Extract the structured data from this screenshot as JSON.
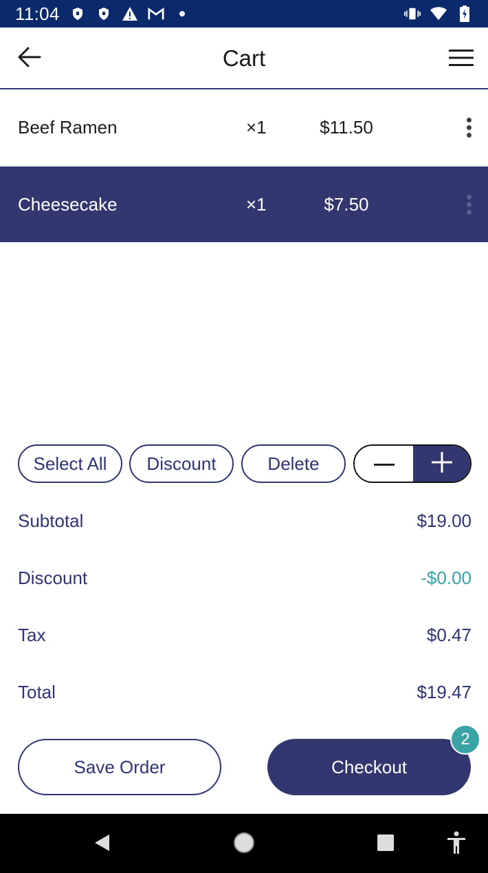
{
  "status_bar": {
    "time": "11:04",
    "icons_left": [
      "shield-icon",
      "shield-icon",
      "warning-icon",
      "gmail-icon",
      "dot-icon"
    ],
    "icons_right": [
      "vibrate-icon",
      "wifi-icon",
      "battery-icon"
    ]
  },
  "app_bar": {
    "title": "Cart",
    "back_icon": "arrow-left-icon",
    "menu_icon": "hamburger-menu-icon"
  },
  "cart": {
    "items": [
      {
        "name": "Beef Ramen",
        "qty": "×1",
        "price": "$11.50",
        "selected": false
      },
      {
        "name": "Cheesecake",
        "qty": "×1",
        "price": "$7.50",
        "selected": true
      }
    ]
  },
  "actions": {
    "select_all": "Select All",
    "discount": "Discount",
    "delete": "Delete"
  },
  "totals": {
    "subtotal_label": "Subtotal",
    "subtotal_value": "$19.00",
    "discount_label": "Discount",
    "discount_value": "-$0.00",
    "tax_label": "Tax",
    "tax_value": "$0.47",
    "total_label": "Total",
    "total_value": "$19.47"
  },
  "footer": {
    "save_order": "Save Order",
    "checkout": "Checkout",
    "checkout_badge": "2"
  },
  "colors": {
    "primary": "#32386f",
    "status_bar": "#0b2a6b",
    "accent": "#3aa3a6"
  }
}
